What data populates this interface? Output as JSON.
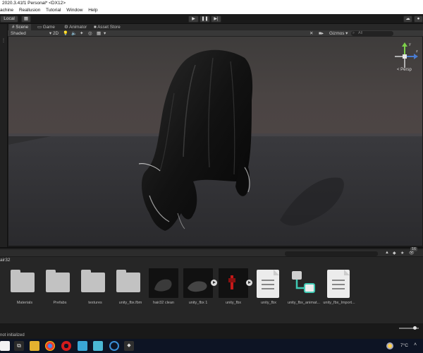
{
  "window": {
    "title": "2020.3.41f1 Personal* <DX12>"
  },
  "menu": [
    "achine",
    "Reallusion",
    "Tutorial",
    "Window",
    "Help"
  ],
  "toolbar": {
    "pivot_label": "Local"
  },
  "tabs": [
    {
      "label": "Scene",
      "active": true
    },
    {
      "label": "Game",
      "active": false
    },
    {
      "label": "Animator",
      "active": false
    },
    {
      "label": "Asset Store",
      "active": false
    }
  ],
  "scene_bar": {
    "shading_mode": "Shaded",
    "mode_2d": "2D",
    "gizmos_label": "Gizmos",
    "search_placeholder": "All"
  },
  "viewport": {
    "persp_label": "< Persp",
    "axis_y": "y",
    "axis_z": "z"
  },
  "project": {
    "breadcrumb": "air32",
    "count_badge": "16",
    "items": [
      {
        "label": "Materials",
        "kind": "folder"
      },
      {
        "label": "Prefabs",
        "kind": "folder"
      },
      {
        "label": "textures",
        "kind": "folder"
      },
      {
        "label": "unity_fbx.fbm",
        "kind": "folder"
      },
      {
        "label": "hair32 clean",
        "kind": "model"
      },
      {
        "label": "unity_fbx 1",
        "kind": "model"
      },
      {
        "label": "unity_fbx",
        "kind": "model"
      },
      {
        "label": "unity_fbx",
        "kind": "doc"
      },
      {
        "label": "unity_fbx_animat...",
        "kind": "anim"
      },
      {
        "label": "unity_fbx_Import...",
        "kind": "doc"
      }
    ]
  },
  "status": {
    "message": "not initialized"
  },
  "taskbar": {
    "temperature": "7°C"
  }
}
